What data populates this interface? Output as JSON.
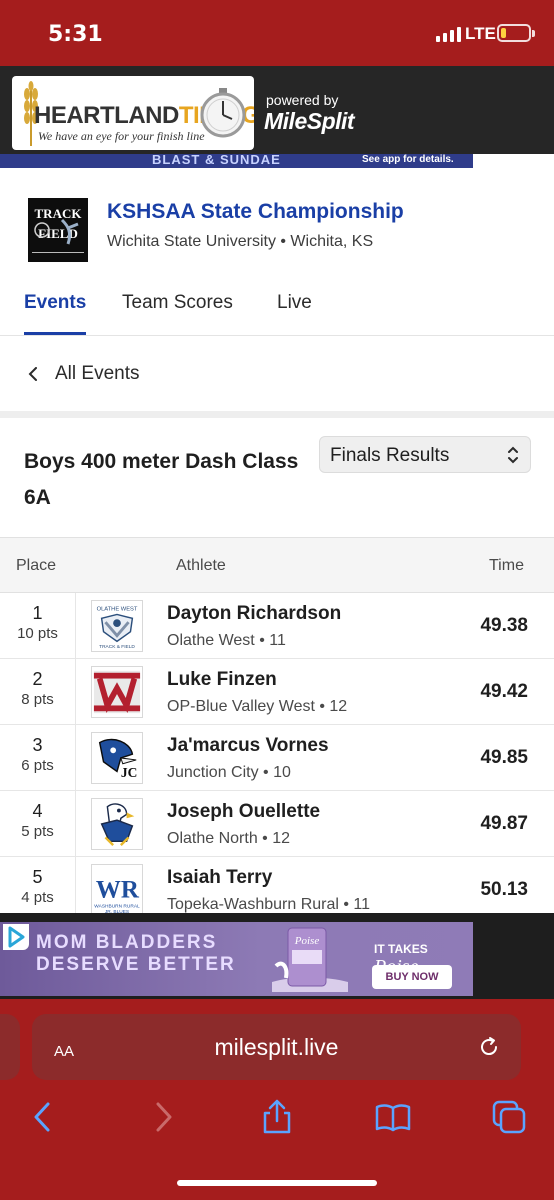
{
  "status_bar": {
    "time": "5:31",
    "network": "LTE",
    "battery_level": 0.2,
    "battery_color": "#ffd23f"
  },
  "header": {
    "logo": {
      "brand_part1": "HEARTLAND",
      "brand_part2": "TIMING",
      "tagline": "We have an eye for your finish line"
    },
    "powered_by": "powered by",
    "powered_brand": "MileSplit"
  },
  "top_ad": {
    "text_left": "BLAST & SUNDAE",
    "text_right": "See app for details."
  },
  "meet": {
    "title": "KSHSAA State Championship",
    "location": "Wichita State University • Wichita, KS",
    "logo_icon": "track-and-field-logo"
  },
  "tabs": [
    {
      "label": "Events",
      "active": true
    },
    {
      "label": "Team Scores",
      "active": false
    },
    {
      "label": "Live",
      "active": false
    }
  ],
  "back_link": {
    "label": "All Events",
    "icon": "chevron-left-icon"
  },
  "event": {
    "title": "Boys 400 meter Dash Class 6A",
    "round_select": {
      "value": "Finals Results",
      "icon": "chevron-up-down-icon"
    }
  },
  "results_table": {
    "headers": {
      "place": "Place",
      "athlete": "Athlete",
      "time": "Time"
    },
    "rows": [
      {
        "place": "1",
        "points": "10 pts",
        "athlete": "Dayton Richardson",
        "school": "Olathe West • 11",
        "time": "49.38",
        "logo": "olathe-west-logo"
      },
      {
        "place": "2",
        "points": "8 pts",
        "athlete": "Luke Finzen",
        "school": "OP-Blue Valley West • 12",
        "time": "49.42",
        "logo": "blue-valley-west-logo"
      },
      {
        "place": "3",
        "points": "6 pts",
        "athlete": "Ja'marcus Vornes",
        "school": "Junction City • 10",
        "time": "49.85",
        "logo": "junction-city-logo"
      },
      {
        "place": "4",
        "points": "5 pts",
        "athlete": "Joseph Ouellette",
        "school": "Olathe North • 12",
        "time": "49.87",
        "logo": "olathe-north-logo"
      },
      {
        "place": "5",
        "points": "4 pts",
        "athlete": "Isaiah Terry",
        "school": "Topeka-Washburn Rural • 11",
        "time": "50.13",
        "logo": "washburn-rural-logo"
      }
    ]
  },
  "bottom_ad": {
    "headline_1": "MOM BLADDERS",
    "headline_2": "DESERVE BETTER",
    "tag_prefix": "IT TAKES",
    "tag_brand": "Poise",
    "cta": "BUY NOW",
    "product_label": "Poise"
  },
  "browser": {
    "text_size_button": "AA",
    "url": "milesplit.live"
  },
  "colors": {
    "chrome_red": "#a51d1d",
    "accent_blue": "#1a3fa6",
    "url_bar": "#8c2b2b"
  }
}
